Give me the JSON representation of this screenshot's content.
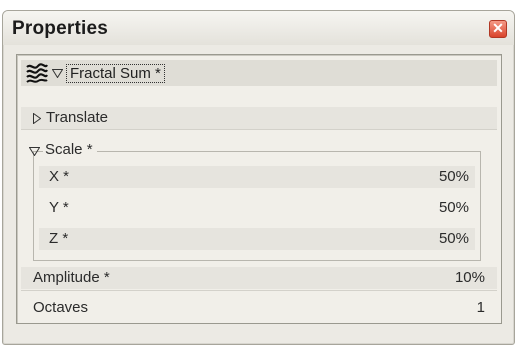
{
  "window": {
    "title": "Properties"
  },
  "tree": {
    "root_label": "Fractal Sum *",
    "translate_label": "Translate",
    "scale_label": "Scale *",
    "scale_items": [
      {
        "label": "X *",
        "value": "50%"
      },
      {
        "label": "Y *",
        "value": "50%"
      },
      {
        "label": "Z *",
        "value": "50%"
      }
    ],
    "properties": [
      {
        "label": "Amplitude *",
        "value": "10%"
      },
      {
        "label": "Octaves",
        "value": "1"
      }
    ]
  },
  "icons": {
    "close": "close-icon",
    "fractal": "fractal-pattern-icon",
    "collapse": "triangle-down-icon",
    "expand": "triangle-right-icon"
  },
  "colors": {
    "window_bg": "#eceae4",
    "close_button": "#d9442b"
  }
}
